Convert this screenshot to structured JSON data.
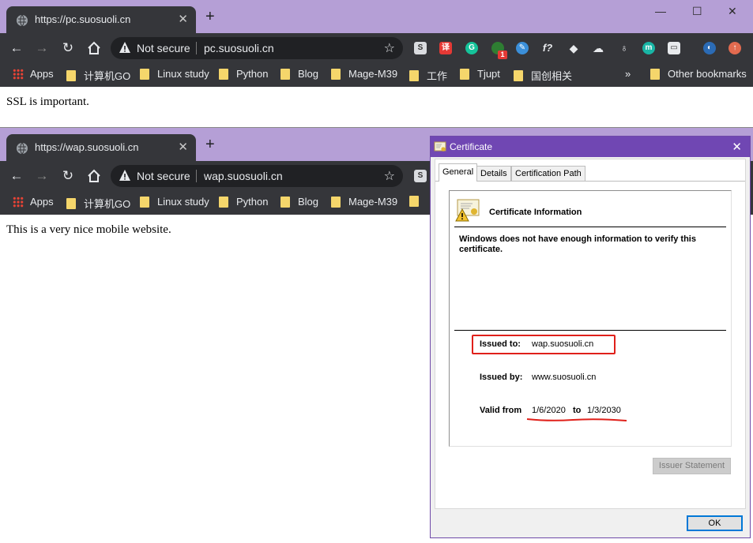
{
  "window1": {
    "tab_title": "https://pc.suosuoli.cn",
    "security": "Not secure",
    "url": "pc.suosuoli.cn",
    "page_text": "SSL is important."
  },
  "window2": {
    "tab_title": "https://wap.suosuoli.cn",
    "security": "Not secure",
    "url": "wap.suosuoli.cn",
    "page_text": "This is a very nice mobile website."
  },
  "bookmarks": {
    "apps": "Apps",
    "items": [
      "计算机GO",
      "Linux study",
      "Python",
      "Blog",
      "Mage-M39",
      "工作",
      "Tjupt",
      "国创相关"
    ],
    "overflow": "»",
    "other": "Other bookmarks"
  },
  "extensions": {
    "icons": [
      "s-ext-icon",
      "translate-ext-icon",
      "grammarly-ext-icon",
      "badge-ext-icon",
      "pen-ext-icon",
      "function-ext-icon",
      "cube-ext-icon",
      "cloud-ext-icon",
      "lamp-ext-icon",
      "m-ext-icon",
      "media-ext-icon",
      "profile-icon",
      "update-icon"
    ],
    "badge_count": "1",
    "function_label": "f?",
    "s_label": "S",
    "m_label": "m"
  },
  "window_controls": {
    "minimize": "—",
    "maximize": "☐",
    "close": "✕"
  },
  "dialog": {
    "title": "Certificate",
    "tabs": [
      "General",
      "Details",
      "Certification Path"
    ],
    "info_title": "Certificate Information",
    "warning": "Windows does not have enough information to verify this certificate.",
    "issued_to_label": "Issued to:",
    "issued_to": "wap.suosuoli.cn",
    "issued_by_label": "Issued by:",
    "issued_by": "www.suosuoli.cn",
    "valid_from_label": "Valid from",
    "valid_from": "1/6/2020",
    "to_label": "to",
    "valid_to": "1/3/2030",
    "issuer_statement": "Issuer Statement",
    "ok": "OK"
  },
  "colors": {
    "tabstrip": "#b59fd6",
    "toolbar": "#35363a",
    "dialog_title": "#7047b3",
    "annotation_red": "#e0201a"
  }
}
